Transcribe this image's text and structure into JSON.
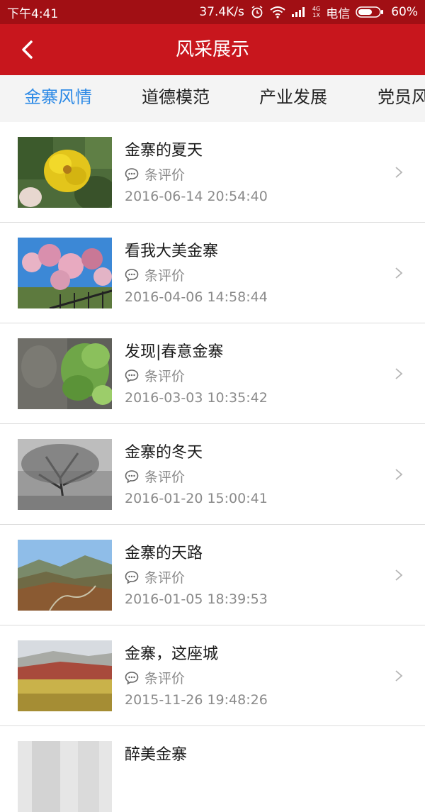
{
  "status_bar": {
    "time": "下午4:41",
    "speed": "37.4K/s",
    "carrier": "电信",
    "battery": "60%",
    "network_badge_top": "4G",
    "network_badge_bottom": "1X"
  },
  "header": {
    "title": "风采展示",
    "back_icon": "chevron-left-icon"
  },
  "tabs": [
    {
      "label": "金寨风情",
      "active": true
    },
    {
      "label": "道德模范",
      "active": false
    },
    {
      "label": "产业发展",
      "active": false
    },
    {
      "label": "党员风采",
      "active": false
    }
  ],
  "colors": {
    "header_bg": "#c8161d",
    "status_bg": "#a10f14",
    "tab_active": "#2d8ae6",
    "meta_text": "#8a8a8a"
  },
  "articles": [
    {
      "title": "金寨的夏天",
      "comment_label": "条评价",
      "date": "2016-06-14 20:54:40",
      "thumb": "yellow-flower"
    },
    {
      "title": "看我大美金寨",
      "comment_label": "条评价",
      "date": "2016-04-06 14:58:44",
      "thumb": "pink-blossoms"
    },
    {
      "title": "发现|春意金寨",
      "comment_label": "条评价",
      "date": "2016-03-03 10:35:42",
      "thumb": "rock-plant"
    },
    {
      "title": "金寨的冬天",
      "comment_label": "条评价",
      "date": "2016-01-20 15:00:41",
      "thumb": "frosted-tree"
    },
    {
      "title": "金寨的天路",
      "comment_label": "条评价",
      "date": "2016-01-05 18:39:53",
      "thumb": "mountain-road"
    },
    {
      "title": "金寨，这座城",
      "comment_label": "条评价",
      "date": "2015-11-26 19:48:26",
      "thumb": "autumn-hills"
    },
    {
      "title": "醉美金寨",
      "comment_label": "",
      "date": "",
      "thumb": "misty"
    }
  ]
}
